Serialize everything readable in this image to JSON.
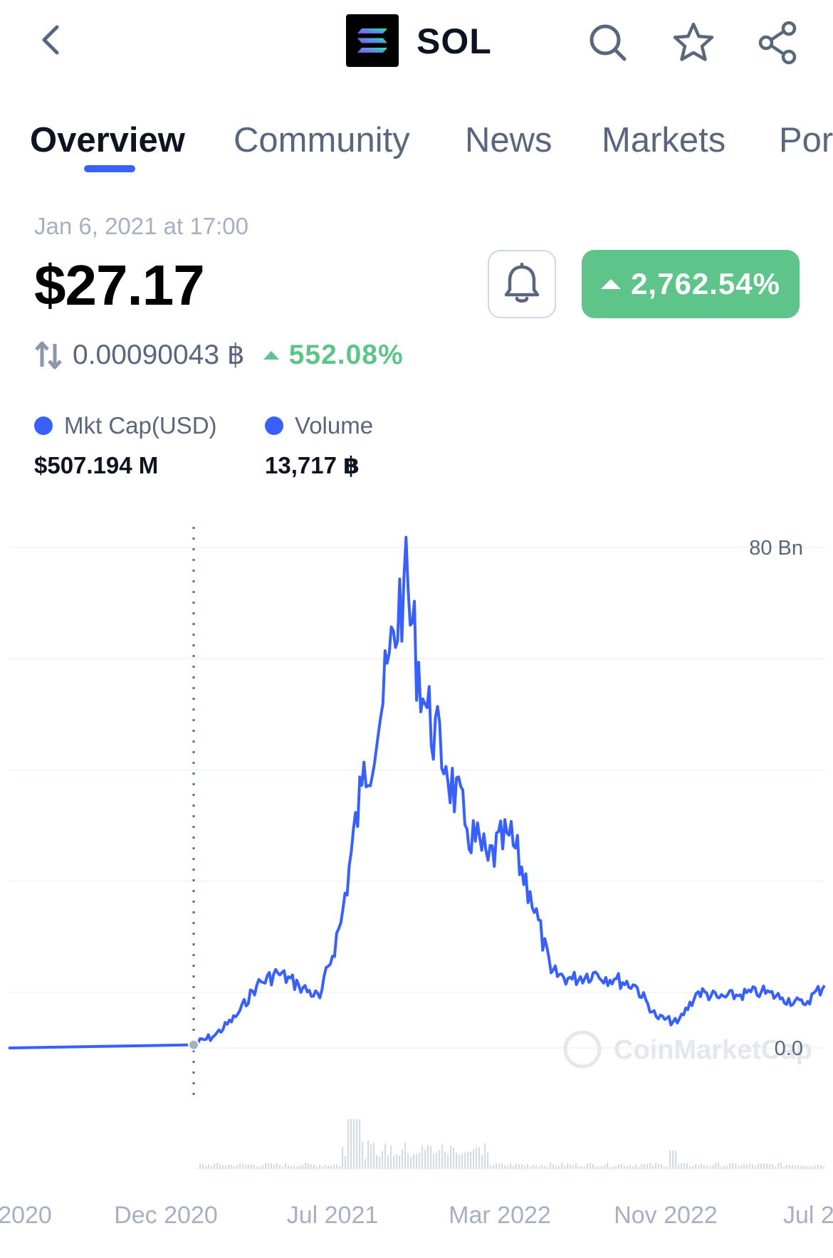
{
  "header": {
    "coin_symbol": "SOL",
    "back_icon": "chevron-left-icon",
    "actions": [
      "search-icon",
      "star-icon",
      "share-icon"
    ]
  },
  "tabs": [
    {
      "label": "Overview",
      "active": true
    },
    {
      "label": "Community",
      "active": false
    },
    {
      "label": "News",
      "active": false
    },
    {
      "label": "Markets",
      "active": false
    },
    {
      "label": "Por",
      "active": false
    }
  ],
  "price": {
    "timestamp": "Jan 6, 2021 at 17:00",
    "usd": "$27.17",
    "change_percent": "2,762.54%",
    "btc_value": "0.00090043 ฿",
    "btc_change_percent": "552.08%"
  },
  "legend": {
    "mkt_cap_label": "Mkt Cap(USD)",
    "mkt_cap_value": "$507.194 M",
    "volume_label": "Volume",
    "volume_value": "13,717 ฿"
  },
  "colors": {
    "accent": "#3861fb",
    "positive": "#5ec48a",
    "muted": "#a6b0c3",
    "secondary_text": "#58667e"
  },
  "watermark": "CoinMarketCap",
  "chart_data": {
    "type": "line",
    "x_ticks": [
      "2020",
      "Dec 2020",
      "Jul 2021",
      "Mar 2022",
      "Nov 2022",
      "Jul 2"
    ],
    "y_ticks": [
      "80 Bn",
      "0.0"
    ],
    "ylim": [
      0,
      80
    ],
    "selected_point": {
      "x": "Jan 6, 2021",
      "y": 0.5
    },
    "series": [
      {
        "values": [
          {
            "x": "Apr 2020",
            "y": 0.0
          },
          {
            "x": "Jan 2021",
            "y": 0.5
          },
          {
            "x": "Feb 2021",
            "y": 2.0
          },
          {
            "x": "Mar 2021",
            "y": 5.0
          },
          {
            "x": "Apr 2021",
            "y": 10.0
          },
          {
            "x": "May 2021",
            "y": 12.0
          },
          {
            "x": "Jun 2021",
            "y": 10.0
          },
          {
            "x": "Jul 2021",
            "y": 8.0
          },
          {
            "x": "Aug 2021",
            "y": 20.0
          },
          {
            "x": "Sep 2021",
            "y": 42.0
          },
          {
            "x": "Oct 2021",
            "y": 55.0
          },
          {
            "x": "Nov 2021",
            "y": 75.0
          },
          {
            "x": "Dec 2021",
            "y": 55.0
          },
          {
            "x": "Jan 2022",
            "y": 45.0
          },
          {
            "x": "Feb 2022",
            "y": 35.0
          },
          {
            "x": "Mar 2022",
            "y": 30.0
          },
          {
            "x": "Apr 2022",
            "y": 34.0
          },
          {
            "x": "May 2022",
            "y": 25.0
          },
          {
            "x": "Jun 2022",
            "y": 12.0
          },
          {
            "x": "Jul 2022",
            "y": 11.0
          },
          {
            "x": "Aug 2022",
            "y": 12.0
          },
          {
            "x": "Sep 2022",
            "y": 11.0
          },
          {
            "x": "Oct 2022",
            "y": 10.0
          },
          {
            "x": "Nov 2022",
            "y": 5.0
          },
          {
            "x": "Dec 2022",
            "y": 4.0
          },
          {
            "x": "Jan 2023",
            "y": 9.0
          },
          {
            "x": "Feb 2023",
            "y": 8.0
          },
          {
            "x": "Mar 2023",
            "y": 8.5
          },
          {
            "x": "Apr 2023",
            "y": 9.0
          },
          {
            "x": "May 2023",
            "y": 8.0
          },
          {
            "x": "Jun 2023",
            "y": 7.0
          },
          {
            "x": "Jul 2023",
            "y": 10.0
          }
        ]
      }
    ]
  }
}
